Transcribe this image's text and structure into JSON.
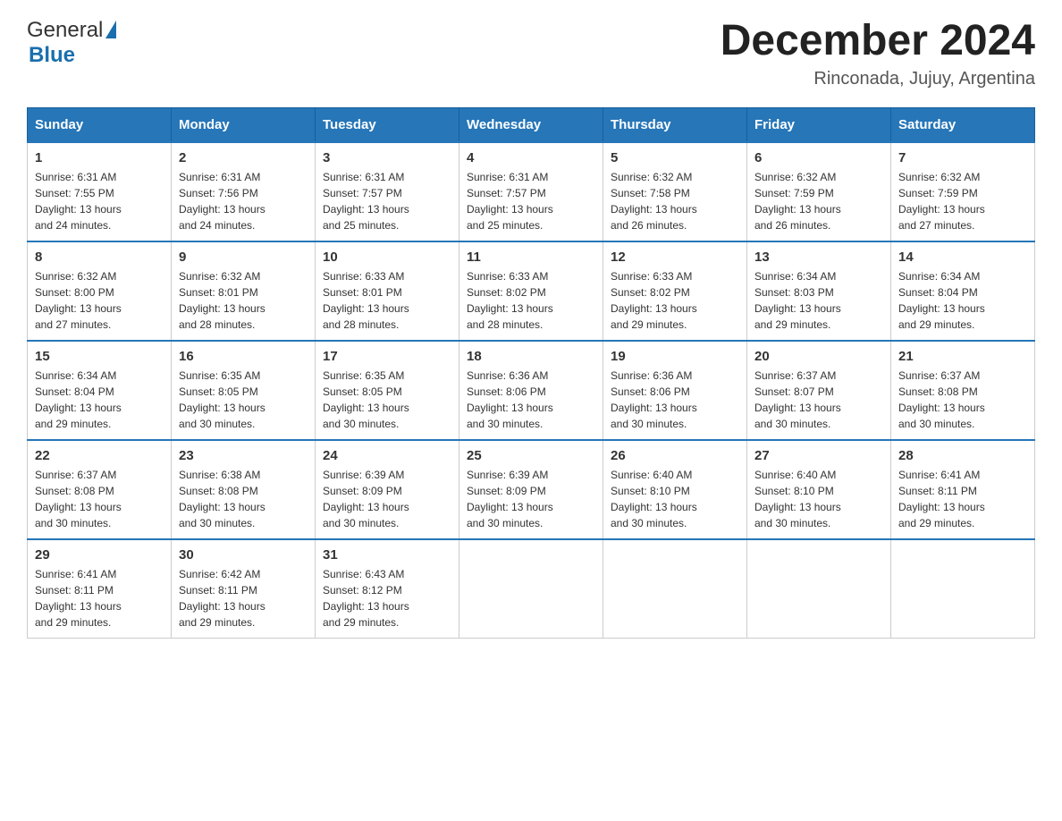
{
  "header": {
    "logo_general": "General",
    "logo_blue": "Blue",
    "month_title": "December 2024",
    "location": "Rinconada, Jujuy, Argentina"
  },
  "days_of_week": [
    "Sunday",
    "Monday",
    "Tuesday",
    "Wednesday",
    "Thursday",
    "Friday",
    "Saturday"
  ],
  "weeks": [
    [
      {
        "day": "1",
        "sunrise": "6:31 AM",
        "sunset": "7:55 PM",
        "daylight": "13 hours and 24 minutes."
      },
      {
        "day": "2",
        "sunrise": "6:31 AM",
        "sunset": "7:56 PM",
        "daylight": "13 hours and 24 minutes."
      },
      {
        "day": "3",
        "sunrise": "6:31 AM",
        "sunset": "7:57 PM",
        "daylight": "13 hours and 25 minutes."
      },
      {
        "day": "4",
        "sunrise": "6:31 AM",
        "sunset": "7:57 PM",
        "daylight": "13 hours and 25 minutes."
      },
      {
        "day": "5",
        "sunrise": "6:32 AM",
        "sunset": "7:58 PM",
        "daylight": "13 hours and 26 minutes."
      },
      {
        "day": "6",
        "sunrise": "6:32 AM",
        "sunset": "7:59 PM",
        "daylight": "13 hours and 26 minutes."
      },
      {
        "day": "7",
        "sunrise": "6:32 AM",
        "sunset": "7:59 PM",
        "daylight": "13 hours and 27 minutes."
      }
    ],
    [
      {
        "day": "8",
        "sunrise": "6:32 AM",
        "sunset": "8:00 PM",
        "daylight": "13 hours and 27 minutes."
      },
      {
        "day": "9",
        "sunrise": "6:32 AM",
        "sunset": "8:01 PM",
        "daylight": "13 hours and 28 minutes."
      },
      {
        "day": "10",
        "sunrise": "6:33 AM",
        "sunset": "8:01 PM",
        "daylight": "13 hours and 28 minutes."
      },
      {
        "day": "11",
        "sunrise": "6:33 AM",
        "sunset": "8:02 PM",
        "daylight": "13 hours and 28 minutes."
      },
      {
        "day": "12",
        "sunrise": "6:33 AM",
        "sunset": "8:02 PM",
        "daylight": "13 hours and 29 minutes."
      },
      {
        "day": "13",
        "sunrise": "6:34 AM",
        "sunset": "8:03 PM",
        "daylight": "13 hours and 29 minutes."
      },
      {
        "day": "14",
        "sunrise": "6:34 AM",
        "sunset": "8:04 PM",
        "daylight": "13 hours and 29 minutes."
      }
    ],
    [
      {
        "day": "15",
        "sunrise": "6:34 AM",
        "sunset": "8:04 PM",
        "daylight": "13 hours and 29 minutes."
      },
      {
        "day": "16",
        "sunrise": "6:35 AM",
        "sunset": "8:05 PM",
        "daylight": "13 hours and 30 minutes."
      },
      {
        "day": "17",
        "sunrise": "6:35 AM",
        "sunset": "8:05 PM",
        "daylight": "13 hours and 30 minutes."
      },
      {
        "day": "18",
        "sunrise": "6:36 AM",
        "sunset": "8:06 PM",
        "daylight": "13 hours and 30 minutes."
      },
      {
        "day": "19",
        "sunrise": "6:36 AM",
        "sunset": "8:06 PM",
        "daylight": "13 hours and 30 minutes."
      },
      {
        "day": "20",
        "sunrise": "6:37 AM",
        "sunset": "8:07 PM",
        "daylight": "13 hours and 30 minutes."
      },
      {
        "day": "21",
        "sunrise": "6:37 AM",
        "sunset": "8:08 PM",
        "daylight": "13 hours and 30 minutes."
      }
    ],
    [
      {
        "day": "22",
        "sunrise": "6:37 AM",
        "sunset": "8:08 PM",
        "daylight": "13 hours and 30 minutes."
      },
      {
        "day": "23",
        "sunrise": "6:38 AM",
        "sunset": "8:08 PM",
        "daylight": "13 hours and 30 minutes."
      },
      {
        "day": "24",
        "sunrise": "6:39 AM",
        "sunset": "8:09 PM",
        "daylight": "13 hours and 30 minutes."
      },
      {
        "day": "25",
        "sunrise": "6:39 AM",
        "sunset": "8:09 PM",
        "daylight": "13 hours and 30 minutes."
      },
      {
        "day": "26",
        "sunrise": "6:40 AM",
        "sunset": "8:10 PM",
        "daylight": "13 hours and 30 minutes."
      },
      {
        "day": "27",
        "sunrise": "6:40 AM",
        "sunset": "8:10 PM",
        "daylight": "13 hours and 30 minutes."
      },
      {
        "day": "28",
        "sunrise": "6:41 AM",
        "sunset": "8:11 PM",
        "daylight": "13 hours and 29 minutes."
      }
    ],
    [
      {
        "day": "29",
        "sunrise": "6:41 AM",
        "sunset": "8:11 PM",
        "daylight": "13 hours and 29 minutes."
      },
      {
        "day": "30",
        "sunrise": "6:42 AM",
        "sunset": "8:11 PM",
        "daylight": "13 hours and 29 minutes."
      },
      {
        "day": "31",
        "sunrise": "6:43 AM",
        "sunset": "8:12 PM",
        "daylight": "13 hours and 29 minutes."
      },
      null,
      null,
      null,
      null
    ]
  ],
  "labels": {
    "sunrise": "Sunrise:",
    "sunset": "Sunset:",
    "daylight": "Daylight:"
  }
}
